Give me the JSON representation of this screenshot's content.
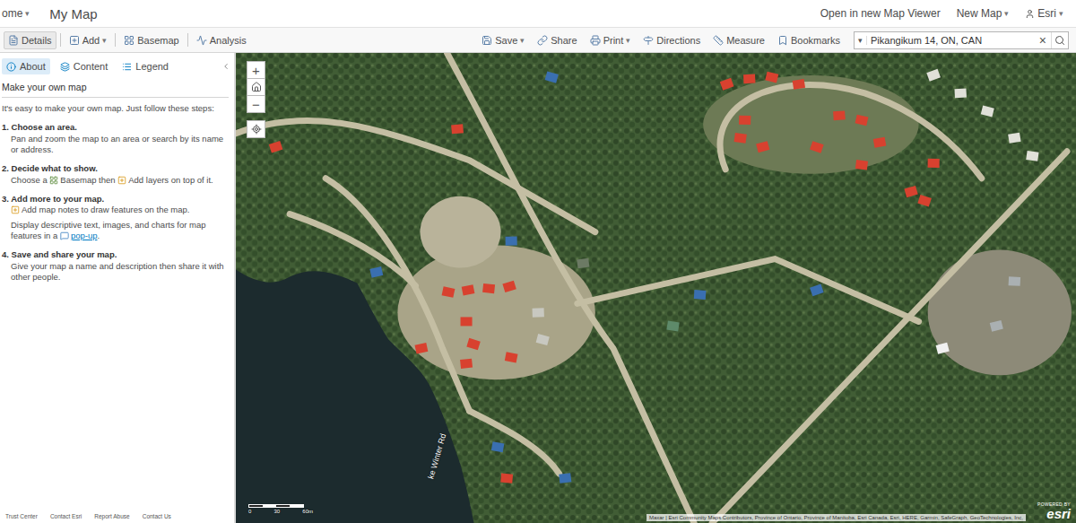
{
  "header": {
    "home": {
      "label": "ome",
      "caret": "▾"
    },
    "title": "My Map",
    "links": [
      {
        "label": "Open in new Map Viewer",
        "caret": ""
      },
      {
        "label": "New Map",
        "caret": "▾"
      },
      {
        "label": "Esri",
        "caret": "▾"
      }
    ]
  },
  "toolbar": {
    "left": [
      {
        "label": "Details",
        "caret": "",
        "selected": true
      },
      {
        "label": "Add",
        "caret": "▾",
        "selected": false
      },
      {
        "label": "Basemap",
        "caret": "",
        "selected": false
      },
      {
        "label": "Analysis",
        "caret": "",
        "selected": false
      }
    ],
    "right": [
      {
        "label": "Save",
        "caret": "▾"
      },
      {
        "label": "Share",
        "caret": ""
      },
      {
        "label": "Print",
        "caret": "▾"
      },
      {
        "label": "Directions",
        "caret": ""
      },
      {
        "label": "Measure",
        "caret": ""
      },
      {
        "label": "Bookmarks",
        "caret": ""
      }
    ],
    "search": {
      "caret": "▾",
      "value": "Pikangikum 14, ON, CAN",
      "clear": "×"
    }
  },
  "sidebar": {
    "tabs": [
      {
        "label": "About",
        "selected": true
      },
      {
        "label": "Content",
        "selected": false
      },
      {
        "label": "Legend",
        "selected": false
      }
    ],
    "heading": "Make your own map",
    "intro": "It's easy to make your own map. Just follow these steps:",
    "steps": [
      {
        "number": "1.",
        "title": "Choose an area.",
        "paras": [
          [
            {
              "text": "Pan and zoom the map to an area or search by its name or address.",
              "icon": false,
              "link": false
            }
          ]
        ]
      },
      {
        "number": "2.",
        "title": "Decide what to show.",
        "paras": [
          [
            {
              "text": "Choose a ",
              "icon": false,
              "link": false
            },
            {
              "text": "Basemap",
              "icon": true,
              "link": false
            },
            {
              "text": " then ",
              "icon": false,
              "link": false
            },
            {
              "text": "Add",
              "icon": true,
              "link": false
            },
            {
              "text": " layers on top of it.",
              "icon": false,
              "link": false
            }
          ]
        ]
      },
      {
        "number": "3.",
        "title": "Add more to your map.",
        "paras": [
          [
            {
              "text": "Add map notes to draw features on the map.",
              "icon": true,
              "link": false
            }
          ],
          [
            {
              "text": "Display descriptive text, images, and charts for map features in a ",
              "icon": false,
              "link": false
            },
            {
              "text": "pop-up",
              "icon": true,
              "link": true
            },
            {
              "text": ".",
              "icon": false,
              "link": false
            }
          ]
        ]
      },
      {
        "number": "4.",
        "title": "Save and share your map.",
        "paras": [
          [
            {
              "text": "Give your map a name and description then share it with other people.",
              "icon": false,
              "link": false
            }
          ]
        ]
      }
    ],
    "footer": [
      "Trust Center",
      "Contact Esri",
      "Report Abuse",
      "Contact Us"
    ]
  },
  "map": {
    "zoom_in": "+",
    "zoom_out": "−",
    "street_label": "ke Winter Rd",
    "scale": [
      "0",
      "30",
      "60m"
    ],
    "attribution": "Maxar | Esri Community Maps Contributors, Province of Ontario, Province of Manitoba, Esri Canada, Esri, HERE, Garmin, SafeGraph, GeoTechnologies, Inc,",
    "logo": {
      "tagline": "POWERED BY",
      "name": "esri"
    }
  }
}
